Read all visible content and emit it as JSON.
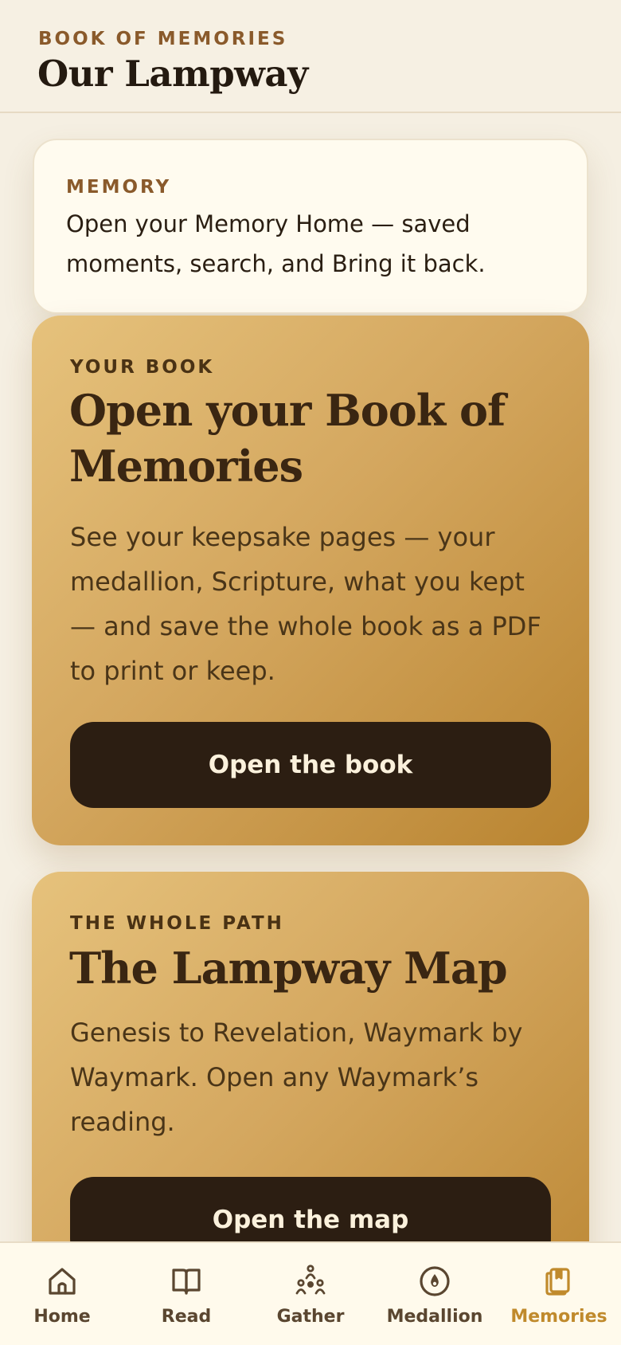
{
  "header": {
    "eyebrow": "BOOK OF MEMORIES",
    "title": "Our Lampway"
  },
  "memory_card": {
    "eyebrow": "MEMORY",
    "text": "Open your Memory Home — saved moments, search, and Bring it back."
  },
  "book_card": {
    "eyebrow": "YOUR BOOK",
    "title": "Open your Book of Memories",
    "body": "See your keepsake pages — your medallion, Scripture, what you kept — and save the whole book as a PDF to print or keep.",
    "button_label": "Open the book"
  },
  "map_card": {
    "eyebrow": "THE WHOLE PATH",
    "title": "The Lampway Map",
    "body": "Genesis to Revelation, Waymark by Waymark. Open any Waymark’s reading.",
    "button_label": "Open the map"
  },
  "nav": {
    "items": [
      {
        "label": "Home",
        "icon": "home-icon",
        "active": false
      },
      {
        "label": "Read",
        "icon": "book-icon",
        "active": false
      },
      {
        "label": "Gather",
        "icon": "people-icon",
        "active": false
      },
      {
        "label": "Medallion",
        "icon": "medallion-icon",
        "active": false
      },
      {
        "label": "Memories",
        "icon": "memories-icon",
        "active": true
      }
    ]
  },
  "colors": {
    "accent": "#c08a2c",
    "eyebrow": "#8a5a2b",
    "button": "#2c1e12",
    "background": "#f5efe2"
  }
}
